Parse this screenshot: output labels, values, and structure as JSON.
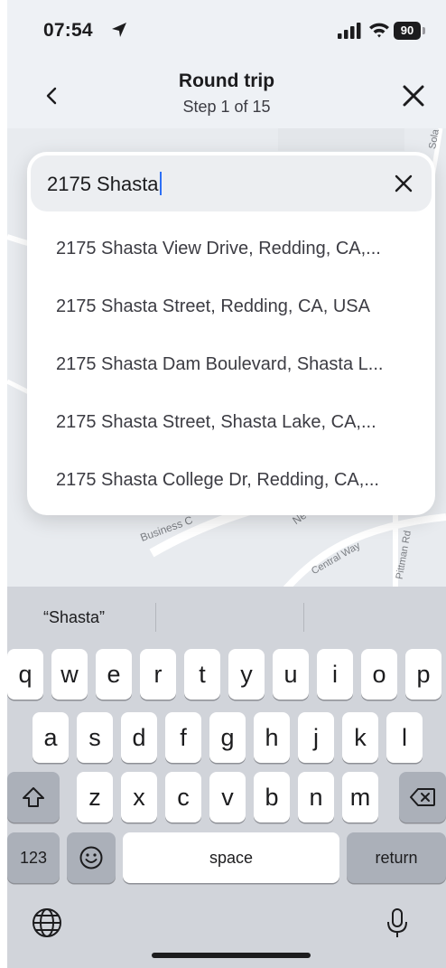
{
  "status": {
    "time": "07:54",
    "battery": "90"
  },
  "header": {
    "title": "Round trip",
    "subtitle": "Step 1 of 15"
  },
  "map": {
    "labels": [
      "Sola",
      "Business C",
      "Ne",
      "Central Way",
      "Pittman Rd"
    ]
  },
  "search": {
    "value": "2175 Shasta",
    "suggestions": [
      "2175 Shasta View Drive, Redding, CA,...",
      "2175 Shasta Street, Redding, CA, USA",
      "2175 Shasta Dam Boulevard, Shasta L...",
      "2175 Shasta Street, Shasta Lake, CA,...",
      "2175 Shasta College Dr, Redding, CA,..."
    ]
  },
  "keyboard": {
    "prediction": "“Shasta”",
    "row1": [
      "q",
      "w",
      "e",
      "r",
      "t",
      "y",
      "u",
      "i",
      "o",
      "p"
    ],
    "row2": [
      "a",
      "s",
      "d",
      "f",
      "g",
      "h",
      "j",
      "k",
      "l"
    ],
    "row3": [
      "z",
      "x",
      "c",
      "v",
      "b",
      "n",
      "m"
    ],
    "numbers_label": "123",
    "space_label": "space",
    "return_label": "return"
  },
  "icons": {
    "location": "location-arrow-icon",
    "signal": "cellular-signal-icon",
    "wifi": "wifi-icon",
    "back": "chevron-left-icon",
    "close": "close-icon",
    "clear": "clear-icon",
    "shift": "shift-icon",
    "delete": "delete-icon",
    "emoji": "emoji-icon",
    "globe": "globe-icon",
    "mic": "microphone-icon"
  }
}
